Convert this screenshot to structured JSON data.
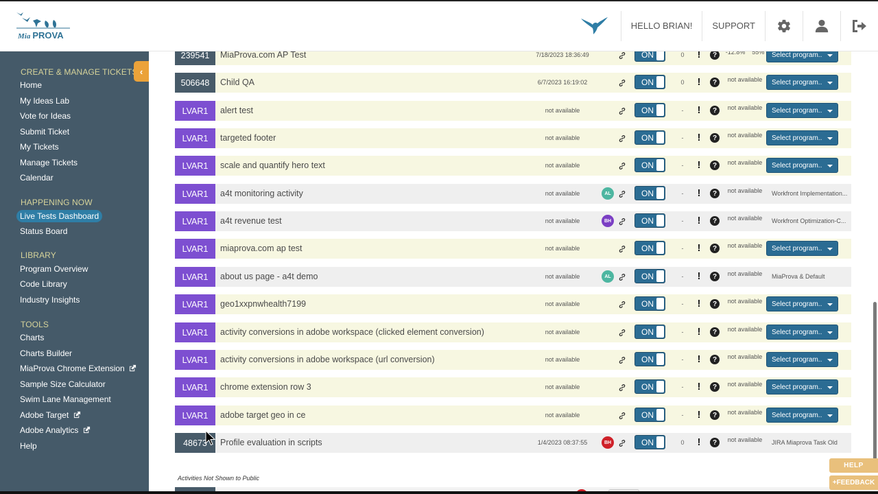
{
  "app": {
    "logo_text_script": "Mia",
    "logo_text_bold": "PROVA"
  },
  "header": {
    "greeting": "HELLO BRIAN!",
    "support": "SUPPORT",
    "icons": [
      "bird-icon",
      "gear-icon",
      "user-icon",
      "logout-icon"
    ]
  },
  "sidebar": {
    "collapse_glyph": "‹",
    "sections": [
      {
        "title": "CREATE & MANAGE TICKETS",
        "items": [
          {
            "label": "Home"
          },
          {
            "label": "My Ideas Lab"
          },
          {
            "label": "Vote for Ideas"
          },
          {
            "label": "Submit Ticket"
          },
          {
            "label": "My Tickets"
          },
          {
            "label": "Manage Tickets"
          },
          {
            "label": "Calendar"
          }
        ]
      },
      {
        "title": "HAPPENING NOW",
        "items": [
          {
            "label": "Live Tests Dashboard",
            "active": true
          },
          {
            "label": "Status Board"
          }
        ]
      },
      {
        "title": "LIBRARY",
        "items": [
          {
            "label": "Program Overview"
          },
          {
            "label": "Code Library"
          },
          {
            "label": "Industry Insights"
          }
        ]
      },
      {
        "title": "TOOLS",
        "items": [
          {
            "label": "Charts"
          },
          {
            "label": "Charts Builder"
          },
          {
            "label": "MiaProva Chrome Extension",
            "external": true
          },
          {
            "label": "Sample Size Calculator"
          },
          {
            "label": "Swim Lane Management"
          },
          {
            "label": "Adobe Target",
            "external": true
          },
          {
            "label": "Adobe Analytics",
            "external": true
          },
          {
            "label": "Help"
          }
        ]
      }
    ]
  },
  "activities": [
    {
      "badge": "239541",
      "badge_type": "id",
      "name": "MiaProva.com AP Test",
      "date": "7/18/2023 18:36:49",
      "avatar": null,
      "toggle": "ON",
      "count": "0",
      "lift": "-12.8%",
      "confidence": "55%",
      "program": "Select program..",
      "program_type": "select",
      "bg": "yellow"
    },
    {
      "badge": "506648",
      "badge_type": "id",
      "name": "Child QA",
      "date": "6/7/2023 16:19:02",
      "avatar": null,
      "toggle": "ON",
      "count": "0",
      "lift": "not available",
      "confidence": "",
      "program": "Select program..",
      "program_type": "select",
      "bg": "yellow"
    },
    {
      "badge": "LVAR1",
      "badge_type": "lvar",
      "name": "alert test",
      "date": "not available",
      "avatar": null,
      "toggle": "ON",
      "count": "-",
      "lift": "not available",
      "confidence": "",
      "program": "Select program..",
      "program_type": "select",
      "bg": "yellow"
    },
    {
      "badge": "LVAR1",
      "badge_type": "lvar",
      "name": "targeted footer",
      "date": "not available",
      "avatar": null,
      "toggle": "ON",
      "count": "-",
      "lift": "not available",
      "confidence": "",
      "program": "Select program..",
      "program_type": "select",
      "bg": "yellow"
    },
    {
      "badge": "LVAR1",
      "badge_type": "lvar",
      "name": "scale and quantify hero text",
      "date": "not available",
      "avatar": null,
      "toggle": "ON",
      "count": "-",
      "lift": "not available",
      "confidence": "",
      "program": "Select program..",
      "program_type": "select",
      "bg": "yellow"
    },
    {
      "badge": "LVAR1",
      "badge_type": "lvar",
      "name": "a4t monitoring activity",
      "date": "not available",
      "avatar": {
        "initials": "AL",
        "color": "#4db6a1"
      },
      "toggle": "ON",
      "count": "-",
      "lift": "not available",
      "confidence": "",
      "program": "Workfront Implementation...",
      "program_type": "text",
      "bg": "gray"
    },
    {
      "badge": "LVAR1",
      "badge_type": "lvar",
      "name": "a4t revenue test",
      "date": "not available",
      "avatar": {
        "initials": "BH",
        "color": "#7b3fc4"
      },
      "toggle": "ON",
      "count": "-",
      "lift": "not available",
      "confidence": "",
      "program": "Workfront Optimization-C...",
      "program_type": "text",
      "bg": "gray"
    },
    {
      "badge": "LVAR1",
      "badge_type": "lvar",
      "name": "miaprova.com ap test",
      "date": "not available",
      "avatar": null,
      "toggle": "ON",
      "count": "-",
      "lift": "not available",
      "confidence": "",
      "program": "Select program..",
      "program_type": "select",
      "bg": "yellow"
    },
    {
      "badge": "LVAR1",
      "badge_type": "lvar",
      "name": "about us page - a4t demo",
      "date": "not available",
      "avatar": {
        "initials": "AL",
        "color": "#4db6a1"
      },
      "toggle": "ON",
      "count": "-",
      "lift": "not available",
      "confidence": "",
      "program": "MiaProva & Default",
      "program_type": "text",
      "bg": "gray"
    },
    {
      "badge": "LVAR1",
      "badge_type": "lvar",
      "name": "geo1xxpnwhealth7199",
      "date": "not available",
      "avatar": null,
      "toggle": "ON",
      "count": "-",
      "lift": "not available",
      "confidence": "",
      "program": "Select program..",
      "program_type": "select",
      "bg": "yellow"
    },
    {
      "badge": "LVAR1",
      "badge_type": "lvar",
      "name": "activity conversions in adobe workspace (clicked element conversion)",
      "date": "not available",
      "avatar": null,
      "toggle": "ON",
      "count": "-",
      "lift": "not available",
      "confidence": "",
      "program": "Select program..",
      "program_type": "select",
      "bg": "yellow"
    },
    {
      "badge": "LVAR1",
      "badge_type": "lvar",
      "name": "activity conversions in adobe workspace (url conversion)",
      "date": "not available",
      "avatar": null,
      "toggle": "ON",
      "count": "-",
      "lift": "not available",
      "confidence": "",
      "program": "Select program..",
      "program_type": "select",
      "bg": "yellow"
    },
    {
      "badge": "LVAR1",
      "badge_type": "lvar",
      "name": "chrome extension row 3",
      "date": "not available",
      "avatar": null,
      "toggle": "ON",
      "count": "-",
      "lift": "not available",
      "confidence": "",
      "program": "Select program..",
      "program_type": "select",
      "bg": "yellow"
    },
    {
      "badge": "LVAR1",
      "badge_type": "lvar",
      "name": "adobe target geo in ce",
      "date": "not available",
      "avatar": null,
      "toggle": "ON",
      "count": "-",
      "lift": "not available",
      "confidence": "",
      "program": "Select program..",
      "program_type": "select",
      "bg": "yellow"
    },
    {
      "badge": "48673",
      "badge_type": "id",
      "name": "Profile evaluation in scripts",
      "date": "1/4/2023 08:37:55",
      "avatar": {
        "initials": "BH",
        "color": "#cf2129"
      },
      "toggle": "ON",
      "count": "0",
      "lift": "not available",
      "confidence": "",
      "program": "JIRA Miaprova Task Old",
      "program_type": "text",
      "bg": "gray"
    }
  ],
  "hidden_section": {
    "label": "Activities Not Shown to Public"
  },
  "floating": {
    "help": "HELP",
    "feedback": "+FEEDBACK"
  },
  "colors": {
    "sidebar_bg": "#455a69",
    "section_title": "#d6d39a",
    "accent_blue": "#2b6c93",
    "lvar_purple": "#7d4fd1",
    "id_badge": "#485b69",
    "row_yellow": "#f7f7e1",
    "row_gray": "#efefef",
    "floating_tab": "#e9c07c",
    "collapse_btn": "#eba23a"
  }
}
